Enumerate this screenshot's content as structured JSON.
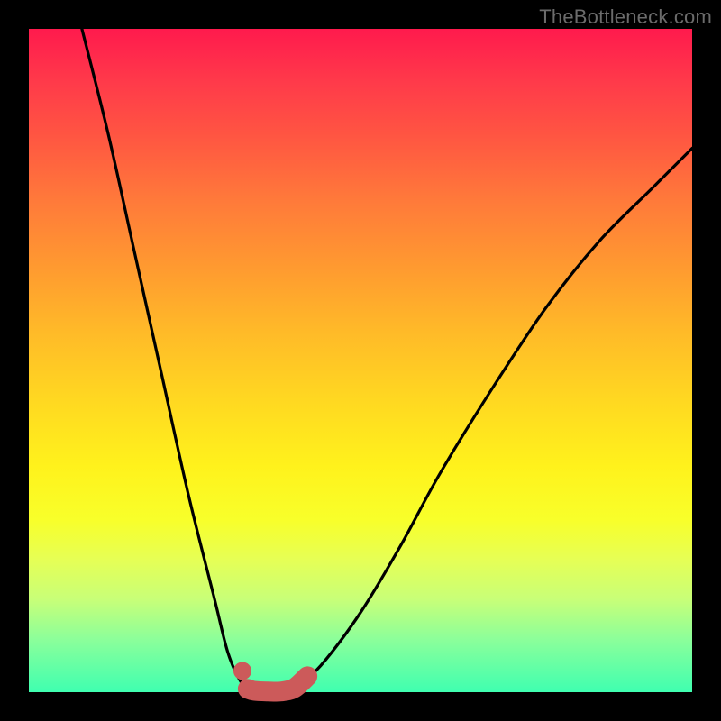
{
  "watermark": "TheBottleneck.com",
  "colors": {
    "curve": "#000000",
    "highlight": "#cc5a5a",
    "frame": "#000000"
  },
  "chart_data": {
    "type": "line",
    "title": "",
    "xlabel": "",
    "ylabel": "",
    "xlim": [
      0,
      100
    ],
    "ylim": [
      0,
      100
    ],
    "grid": false,
    "legend": false,
    "series": [
      {
        "name": "left-branch",
        "x": [
          8,
          12,
          16,
          20,
          24,
          28,
          30,
          32,
          33.5
        ],
        "y": [
          100,
          84,
          66,
          48,
          30,
          14,
          6,
          1.5,
          0.5
        ]
      },
      {
        "name": "right-branch",
        "x": [
          40,
          44,
          50,
          56,
          62,
          70,
          78,
          86,
          94,
          100
        ],
        "y": [
          0.5,
          4,
          12,
          22,
          33,
          46,
          58,
          68,
          76,
          82
        ]
      },
      {
        "name": "highlight-bottom",
        "x": [
          33,
          34,
          36,
          38,
          40,
          42
        ],
        "y": [
          0.5,
          0.2,
          0.1,
          0.1,
          0.6,
          2.4
        ]
      }
    ],
    "annotations": [
      {
        "name": "highlight-dot",
        "x": 32.2,
        "y": 3.2
      }
    ]
  }
}
